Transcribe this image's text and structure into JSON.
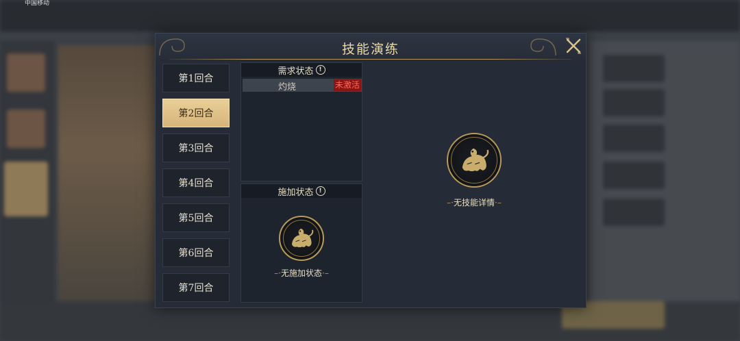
{
  "status_bar": {
    "carrier": "中国移动"
  },
  "dialog": {
    "title": "技能演练",
    "close_icon": "close-icon"
  },
  "rounds": [
    {
      "label": "第1回合",
      "active": false
    },
    {
      "label": "第2回合",
      "active": true
    },
    {
      "label": "第3回合",
      "active": false
    },
    {
      "label": "第4回合",
      "active": false
    },
    {
      "label": "第5回合",
      "active": false
    },
    {
      "label": "第6回合",
      "active": false
    },
    {
      "label": "第7回合",
      "active": false
    }
  ],
  "required_state": {
    "header": "需求状态",
    "info_icon": "!",
    "rows": [
      {
        "name": "灼烧",
        "status": "未激活"
      }
    ]
  },
  "applied_state": {
    "header": "施加状态",
    "info_icon": "!",
    "empty_text": "无施加状态"
  },
  "skill_detail": {
    "empty_text": "无技能详情"
  },
  "colors": {
    "accent_gold": "#e9cf97",
    "inactive_red": "#8b1414",
    "panel_bg": "#1e242e"
  }
}
